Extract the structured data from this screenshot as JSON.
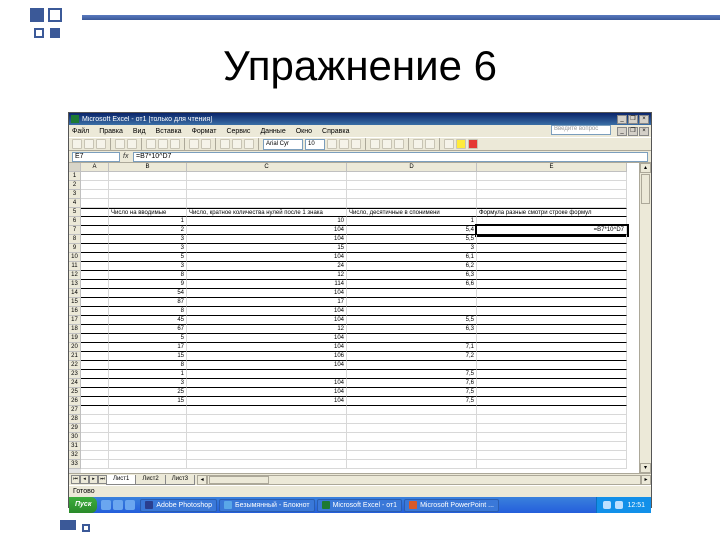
{
  "slide_title": "Упражнение 6",
  "titlebar": "Microsoft Excel - от1 [только для чтения]",
  "win": {
    "min": "_",
    "max": "❐",
    "close": "×"
  },
  "menu": [
    "Файл",
    "Правка",
    "Вид",
    "Вставка",
    "Формат",
    "Сервис",
    "Данные",
    "Окно",
    "Справка"
  ],
  "askbox": "Введите вопрос",
  "font": "Arial Cyr",
  "fsize": "10",
  "namebox": "E7",
  "formula": "=B7*10^D7",
  "cols": [
    "A",
    "B",
    "C",
    "D",
    "E"
  ],
  "headers": {
    "B": "Число на вводимые",
    "C": "Число, кратное количества нулей после 1 знака",
    "D": "Число, десятичные в спонимени",
    "E": "Формула разные смотри строке формул"
  },
  "e7": "=B7*10^D7",
  "rows": [
    {
      "n": "1"
    },
    {
      "n": "2"
    },
    {
      "n": "3"
    },
    {
      "n": "4"
    },
    {
      "n": "5",
      "B": "",
      "C": "",
      "D": "",
      "E": "",
      "hdr": true
    },
    {
      "n": "6",
      "B": "1",
      "C": "10",
      "D": "1",
      "E": ""
    },
    {
      "n": "7",
      "B": "2",
      "C": "104",
      "D": "5,4",
      "E": ""
    },
    {
      "n": "8",
      "B": "3",
      "C": "104",
      "D": "5,5",
      "E": ""
    },
    {
      "n": "9",
      "B": "3",
      "C": "15",
      "D": "3",
      "E": ""
    },
    {
      "n": "10",
      "B": "5",
      "C": "104",
      "D": "6,1",
      "E": ""
    },
    {
      "n": "11",
      "B": "3",
      "C": "24",
      "D": "6,2",
      "E": ""
    },
    {
      "n": "12",
      "B": "8",
      "C": "12",
      "D": "6,3",
      "E": ""
    },
    {
      "n": "13",
      "B": "9",
      "C": "114",
      "D": "6,6",
      "E": ""
    },
    {
      "n": "14",
      "B": "54",
      "C": "104",
      "D": "",
      "E": ""
    },
    {
      "n": "15",
      "B": "87",
      "C": "17",
      "D": "",
      "E": ""
    },
    {
      "n": "16",
      "B": "8",
      "C": "104",
      "D": "",
      "E": ""
    },
    {
      "n": "17",
      "B": "45",
      "C": "104",
      "D": "5,5",
      "E": ""
    },
    {
      "n": "18",
      "B": "67",
      "C": "12",
      "D": "6,3",
      "E": ""
    },
    {
      "n": "19",
      "B": "5",
      "C": "104",
      "D": "",
      "E": ""
    },
    {
      "n": "20",
      "B": "17",
      "C": "104",
      "D": "7,1",
      "E": ""
    },
    {
      "n": "21",
      "B": "15",
      "C": "106",
      "D": "7,2",
      "E": ""
    },
    {
      "n": "22",
      "B": "8",
      "C": "104",
      "D": "",
      "E": ""
    },
    {
      "n": "23",
      "B": "1",
      "C": "",
      "D": "7,5",
      "E": ""
    },
    {
      "n": "24",
      "B": "3",
      "C": "104",
      "D": "7,6",
      "E": ""
    },
    {
      "n": "25",
      "B": "25",
      "C": "104",
      "D": "7,5",
      "E": ""
    },
    {
      "n": "26",
      "B": "15",
      "C": "104",
      "D": "7,5",
      "E": ""
    },
    {
      "n": "27"
    },
    {
      "n": "28"
    },
    {
      "n": "29"
    },
    {
      "n": "30"
    },
    {
      "n": "31"
    },
    {
      "n": "32"
    },
    {
      "n": "33"
    }
  ],
  "sheets": [
    "Лист1",
    "Лист2",
    "Лист3"
  ],
  "status": "Готово",
  "taskbar": {
    "start": "Пуск",
    "tasks": [
      {
        "label": "Adobe Photoshop",
        "color": "#2a3f8f"
      },
      {
        "label": "Безымянный - Блокнот",
        "color": "#5aa7e8"
      },
      {
        "label": "Microsoft Excel - от1",
        "color": "#1d7a34"
      },
      {
        "label": "Microsoft PowerPoint ...",
        "color": "#d85a2a"
      }
    ],
    "clock": "12:51"
  }
}
